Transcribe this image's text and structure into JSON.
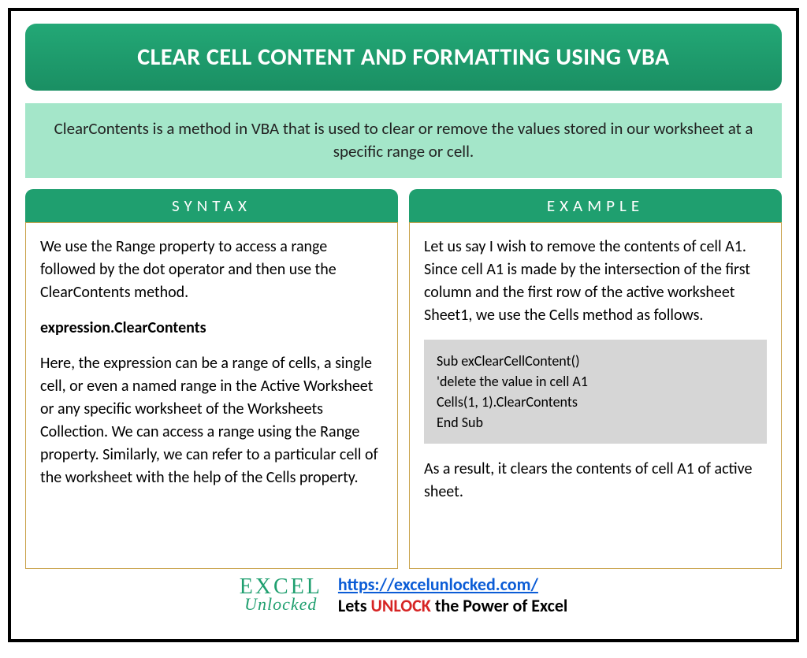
{
  "title": "CLEAR CELL CONTENT AND FORMATTING USING VBA",
  "description": "ClearContents is a method in VBA that is used to clear or remove the values stored in our worksheet at a specific range or cell.",
  "syntax": {
    "header": "SYNTAX",
    "para1": "We use the Range property to access a range followed by the dot operator and then use the ClearContents method.",
    "expression": "expression.ClearContents",
    "para2": "Here, the expression can be a range of cells, a single cell, or even a named range in the Active Worksheet or any specific worksheet of the Worksheets Collection. We can access a range using the Range property. Similarly, we can refer to a particular cell of the worksheet with the help of the Cells property."
  },
  "example": {
    "header": "EXAMPLE",
    "para1": "Let us say I wish to remove the contents of cell A1. Since cell A1 is made by the intersection of the first column and the first row of the active worksheet Sheet1, we use the Cells method as follows.",
    "code": "Sub exClearCellContent()\n'delete the value in cell A1\nCells(1, 1).ClearContents\nEnd Sub",
    "para2": "As a result, it clears the contents of cell A1 of active sheet."
  },
  "footer": {
    "logo_line1": "EXCEL",
    "logo_line2": "Unlocked",
    "url": "https://excelunlocked.com/",
    "tag_prefix": "Lets ",
    "tag_unlock": "UNLOCK",
    "tag_suffix": " the Power of Excel"
  }
}
